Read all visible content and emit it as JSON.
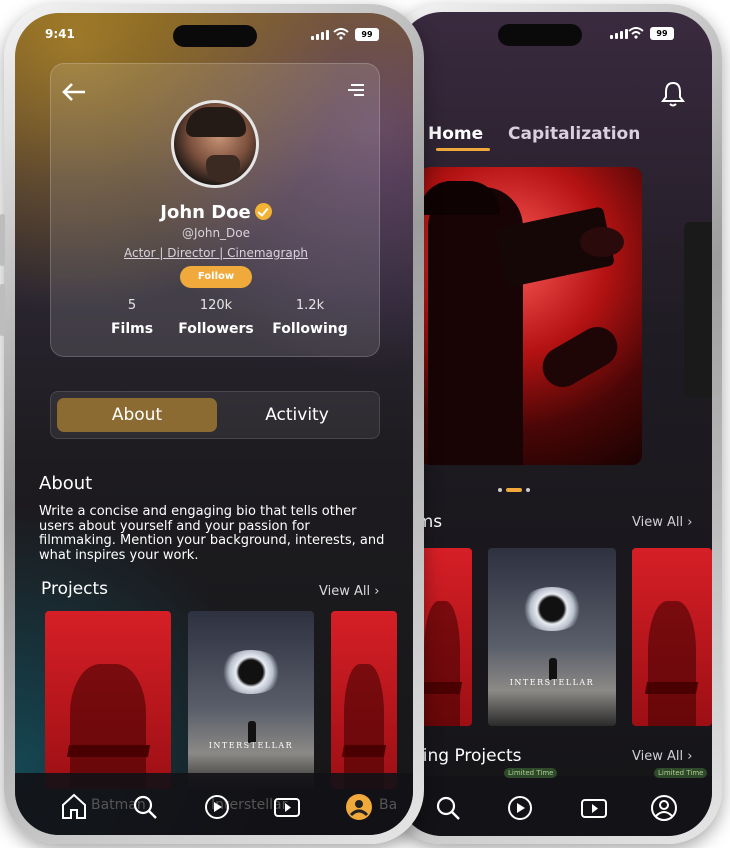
{
  "colors": {
    "accent": "#f0a93b",
    "tab_active": "#8b6b31",
    "verified": "#f2b233"
  },
  "back_phone": {
    "tabs": [
      {
        "label": "Home",
        "active": true
      },
      {
        "label": "Capitalization",
        "active": false
      }
    ],
    "films_title_partial": "lms",
    "view_all": "View All",
    "upcoming_title_partial": "ning Projects",
    "badges": [
      "Limited Time",
      "Limited Time"
    ],
    "posters": [
      {
        "type": "batman"
      },
      {
        "type": "interstellar",
        "title": "INTERSTELLAR"
      },
      {
        "type": "batman"
      }
    ],
    "carousel_dots": 3,
    "nav_icons": [
      "search-icon",
      "play-icon",
      "youtube-icon",
      "profile-icon"
    ]
  },
  "front_phone": {
    "status_time": "9:41",
    "battery": "99",
    "profile": {
      "name": "John Doe",
      "handle": "@John_Doe",
      "roles": "Actor | Director | Cinemagraph",
      "follow_label": "Follow",
      "stats": [
        {
          "value": "5",
          "label": "Films"
        },
        {
          "value": "120k",
          "label": "Followers"
        },
        {
          "value": "1.2k",
          "label": "Following"
        }
      ]
    },
    "toggle": {
      "about": "About",
      "activity": "Activity",
      "active": "About"
    },
    "about": {
      "heading": "About",
      "bio": "Write a concise and engaging bio that tells other users about yourself and your passion for filmmaking. Mention your background, interests, and what inspires your work."
    },
    "projects": {
      "heading": "Projects",
      "view_all": "View All",
      "items": [
        {
          "type": "batman",
          "label": "Batman"
        },
        {
          "type": "interstellar",
          "label": "Interstellar",
          "title": "INTERSTELLAR"
        },
        {
          "type": "batman",
          "label": "Ba"
        }
      ]
    },
    "nav_icons": [
      "home-icon",
      "search-icon",
      "play-icon",
      "youtube-icon",
      "profile-icon"
    ]
  }
}
